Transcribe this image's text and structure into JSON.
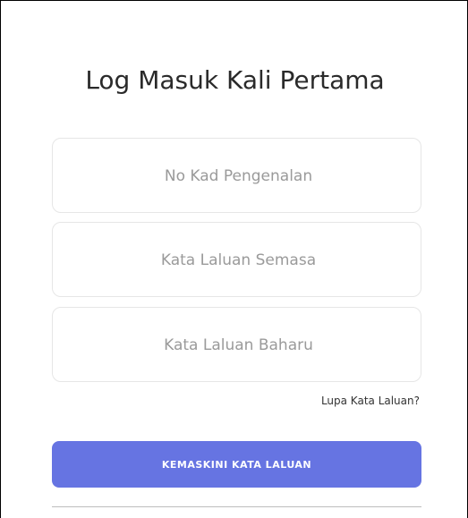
{
  "form": {
    "title": "Log Masuk Kali Pertama",
    "fields": [
      {
        "placeholder": "No Kad Pengenalan",
        "value": ""
      },
      {
        "placeholder": "Kata Laluan Semasa",
        "value": ""
      },
      {
        "placeholder": "Kata Laluan Baharu",
        "value": ""
      }
    ],
    "forgot_link": "Lupa Kata Laluan?",
    "submit_label": "KEMASKINI KATA LALUAN"
  },
  "colors": {
    "accent": "#6674e2",
    "field_border": "#e6e6e6",
    "placeholder": "#9a9a9a"
  }
}
